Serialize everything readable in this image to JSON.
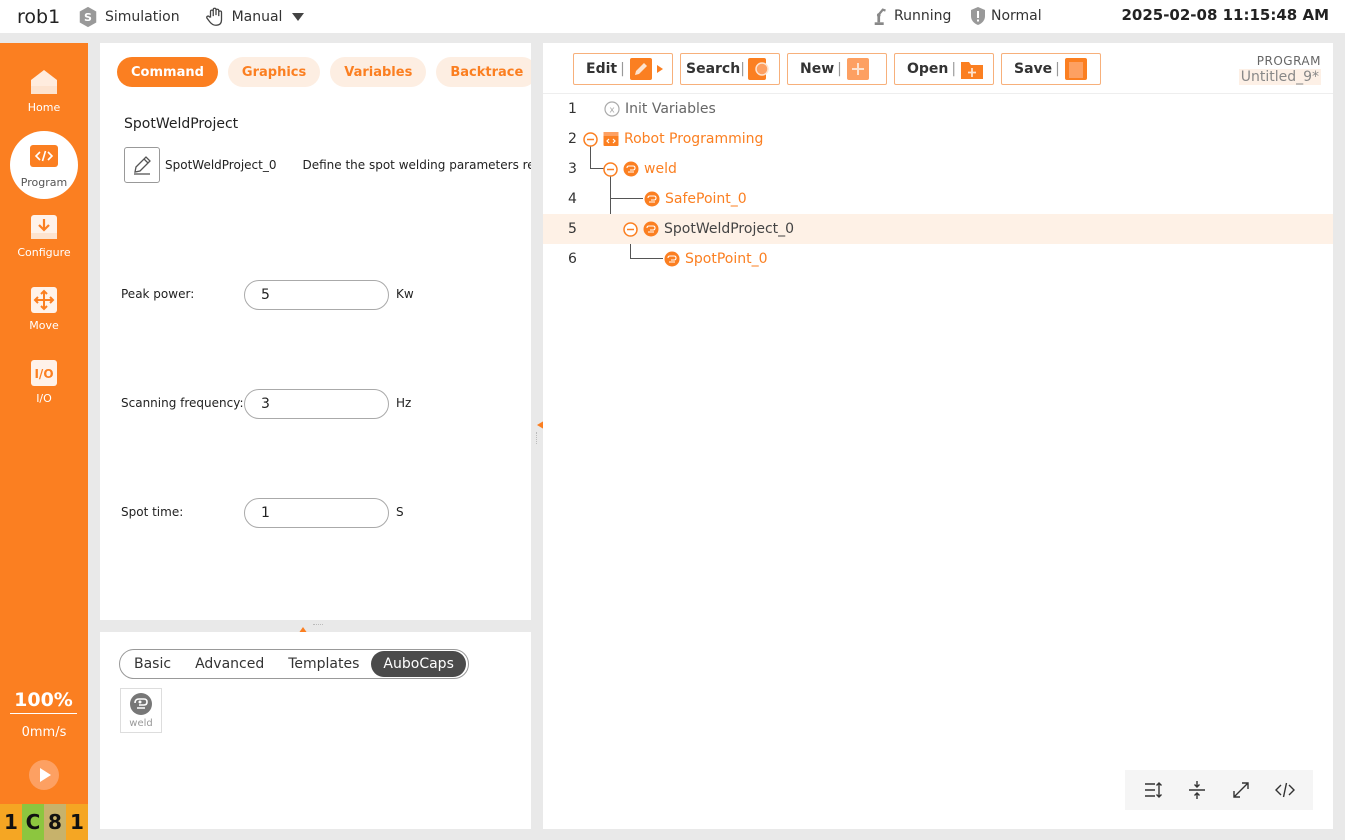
{
  "topbar": {
    "robot_name": "rob1",
    "simulation_label": "Simulation",
    "manual_label": "Manual",
    "running_label": "Running",
    "normal_label": "Normal",
    "datetime": "2025-02-08 11:15:48 AM"
  },
  "sidebar": {
    "items": [
      {
        "label": "Home",
        "icon": "home-icon"
      },
      {
        "label": "Program",
        "icon": "code-icon"
      },
      {
        "label": "Configure",
        "icon": "download-icon"
      },
      {
        "label": "Move",
        "icon": "move-arrows-icon"
      },
      {
        "label": "I/O",
        "icon": "io-icon"
      }
    ],
    "speed_percent": "100%",
    "speed_mm": "0mm/s",
    "codes": [
      {
        "text": "1",
        "color": "#f5a623"
      },
      {
        "text": "C",
        "color": "#8cc63f"
      },
      {
        "text": "8",
        "color": "#c7b26b"
      },
      {
        "text": "1",
        "color": "#f5a623"
      }
    ]
  },
  "command_panel": {
    "tabs": [
      "Command",
      "Graphics",
      "Variables",
      "Backtrace"
    ],
    "project_title": "SpotWeldProject",
    "project_name": "SpotWeldProject_0",
    "project_desc": "Define the spot welding parameters re",
    "fields": [
      {
        "label": "Peak power:",
        "value": "5",
        "unit": "Kw"
      },
      {
        "label": "Scanning frequency:",
        "value": "3",
        "unit": "Hz"
      },
      {
        "label": "Spot time:",
        "value": "1",
        "unit": "S"
      }
    ]
  },
  "library_panel": {
    "tabs": [
      "Basic",
      "Advanced",
      "Templates",
      "AuboCaps"
    ],
    "cap_label": "weld"
  },
  "program_panel": {
    "toolbar": [
      {
        "label": "Edit",
        "icon": "edit-icon"
      },
      {
        "label": "Search",
        "icon": "search-icon"
      },
      {
        "label": "New",
        "icon": "new-icon"
      },
      {
        "label": "Open",
        "icon": "open-folder-icon"
      },
      {
        "label": "Save",
        "icon": "save-icon"
      }
    ],
    "program_label": "PROGRAM",
    "program_file": "Untitled_9*",
    "lines": [
      {
        "no": "1",
        "text": "Init Variables"
      },
      {
        "no": "2",
        "text": "Robot Programming"
      },
      {
        "no": "3",
        "text": "weld"
      },
      {
        "no": "4",
        "text": "SafePoint_0"
      },
      {
        "no": "5",
        "text": "SpotWeldProject_0"
      },
      {
        "no": "6",
        "text": "SpotPoint_0"
      }
    ]
  },
  "colors": {
    "accent": "#fb7f21",
    "accent_light": "#fdeee2",
    "selected_row": "#fef1e6"
  }
}
